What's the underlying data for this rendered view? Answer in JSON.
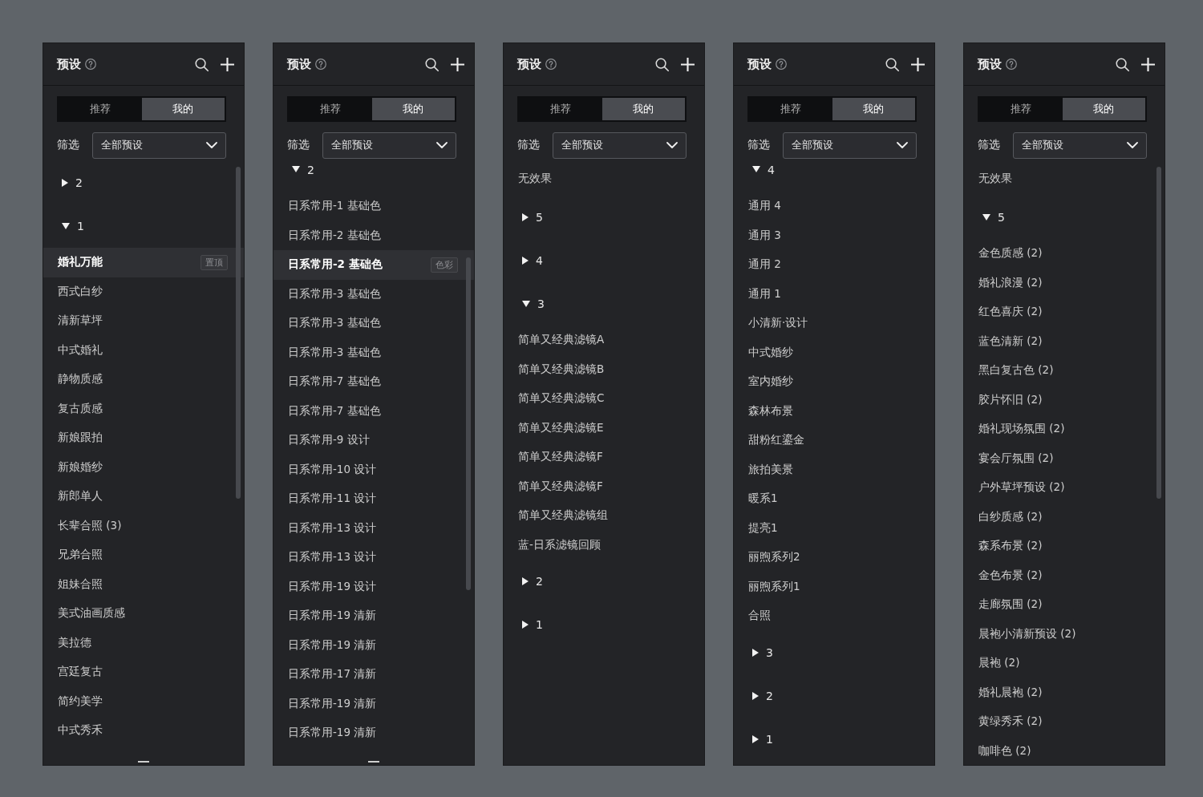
{
  "panels": [
    {
      "title": "预设",
      "tabs": [
        {
          "label": "推荐",
          "selected": false
        },
        {
          "label": "我的",
          "selected": true
        }
      ],
      "filter": {
        "label": "筛选",
        "value": "全部预设"
      },
      "scrolled": false,
      "scrollbar": true,
      "more_below": true,
      "list": [
        {
          "kind": "group",
          "label": "2",
          "expanded": false
        },
        {
          "kind": "group",
          "label": "1",
          "expanded": true,
          "children": [
            {
              "label": "婚礼万能",
              "selected": true,
              "badge": "置顶"
            },
            {
              "label": "西式白纱",
              "selected": false
            },
            {
              "label": "清新草坪",
              "selected": false
            },
            {
              "label": "中式婚礼",
              "selected": false
            },
            {
              "label": "静物质感",
              "selected": false
            },
            {
              "label": "复古质感",
              "selected": false
            },
            {
              "label": "新娘跟拍",
              "selected": false
            },
            {
              "label": "新娘婚纱",
              "selected": false
            },
            {
              "label": "新郎单人",
              "selected": false
            },
            {
              "label": "长辈合照 (3)",
              "selected": false
            },
            {
              "label": "兄弟合照",
              "selected": false
            },
            {
              "label": "姐妹合照",
              "selected": false
            },
            {
              "label": "美式油画质感",
              "selected": false
            },
            {
              "label": "美拉德",
              "selected": false
            },
            {
              "label": "宫廷复古",
              "selected": false
            },
            {
              "label": "简约美学",
              "selected": false
            },
            {
              "label": "中式秀禾",
              "selected": false
            }
          ]
        }
      ]
    },
    {
      "title": "预设",
      "tabs": [
        {
          "label": "推荐",
          "selected": false
        },
        {
          "label": "我的",
          "selected": true
        }
      ],
      "filter": {
        "label": "筛选",
        "value": "全部预设"
      },
      "scrolled": true,
      "scrollbar": true,
      "more_below": true,
      "list": [
        {
          "kind": "group",
          "label": "2",
          "expanded": true,
          "children": [
            {
              "label": "日系常用-1 基础色",
              "selected": false
            },
            {
              "label": "日系常用-2 基础色",
              "selected": false
            },
            {
              "label": "日系常用-2 基础色",
              "selected": true,
              "badge": "色彩"
            },
            {
              "label": "日系常用-3 基础色",
              "selected": false
            },
            {
              "label": "日系常用-3 基础色",
              "selected": false
            },
            {
              "label": "日系常用-3 基础色",
              "selected": false
            },
            {
              "label": "日系常用-7 基础色",
              "selected": false
            },
            {
              "label": "日系常用-7 基础色",
              "selected": false
            },
            {
              "label": "日系常用-9 设计",
              "selected": false
            },
            {
              "label": "日系常用-10 设计",
              "selected": false
            },
            {
              "label": "日系常用-11 设计",
              "selected": false
            },
            {
              "label": "日系常用-13 设计",
              "selected": false
            },
            {
              "label": "日系常用-13 设计",
              "selected": false
            },
            {
              "label": "日系常用-19 设计",
              "selected": false
            },
            {
              "label": "日系常用-19 清新",
              "selected": false
            },
            {
              "label": "日系常用-19 清新",
              "selected": false
            },
            {
              "label": "日系常用-17 清新",
              "selected": false
            },
            {
              "label": "日系常用-19 清新",
              "selected": false
            },
            {
              "label": "日系常用-19 清新",
              "selected": false
            }
          ]
        }
      ]
    },
    {
      "title": "预设",
      "tabs": [
        {
          "label": "推荐",
          "selected": false
        },
        {
          "label": "我的",
          "selected": true
        }
      ],
      "filter": {
        "label": "筛选",
        "value": "全部预设"
      },
      "scrolled": false,
      "scrollbar": false,
      "more_below": false,
      "list": [
        {
          "kind": "item",
          "label": "无效果",
          "selected": false
        },
        {
          "kind": "group",
          "label": "5",
          "expanded": false
        },
        {
          "kind": "group",
          "label": "4",
          "expanded": false
        },
        {
          "kind": "group",
          "label": "3",
          "expanded": true,
          "children": [
            {
              "label": "简单又经典滤镜A",
              "selected": false
            },
            {
              "label": "简单又经典滤镜B",
              "selected": false
            },
            {
              "label": "简单又经典滤镜C",
              "selected": false
            },
            {
              "label": "简单又经典滤镜E",
              "selected": false
            },
            {
              "label": "简单又经典滤镜F",
              "selected": false
            },
            {
              "label": "简单又经典滤镜F",
              "selected": false
            },
            {
              "label": "简单又经典滤镜组",
              "selected": false
            },
            {
              "label": "蓝-日系滤镜回顾",
              "selected": false
            }
          ]
        },
        {
          "kind": "group",
          "label": "2",
          "expanded": false
        },
        {
          "kind": "group",
          "label": "1",
          "expanded": false
        }
      ]
    },
    {
      "title": "预设",
      "tabs": [
        {
          "label": "推荐",
          "selected": false
        },
        {
          "label": "我的",
          "selected": true
        }
      ],
      "filter": {
        "label": "筛选",
        "value": "全部预设"
      },
      "scrolled": true,
      "scrollbar": false,
      "more_below": false,
      "list": [
        {
          "kind": "group",
          "label": "4",
          "expanded": true,
          "children": [
            {
              "label": "通用 4",
              "selected": false
            },
            {
              "label": "通用 3",
              "selected": false
            },
            {
              "label": "通用 2",
              "selected": false
            },
            {
              "label": "通用 1",
              "selected": false
            },
            {
              "label": "小清新·设计",
              "selected": false
            },
            {
              "label": "中式婚纱",
              "selected": false
            },
            {
              "label": "室内婚纱",
              "selected": false
            },
            {
              "label": "森林布景",
              "selected": false
            },
            {
              "label": "甜粉红鎏金",
              "selected": false
            },
            {
              "label": "旅拍美景",
              "selected": false
            },
            {
              "label": "暖系1",
              "selected": false
            },
            {
              "label": "提亮1",
              "selected": false
            },
            {
              "label": "丽煦系列2",
              "selected": false
            },
            {
              "label": "丽煦系列1",
              "selected": false
            },
            {
              "label": "合照",
              "selected": false
            }
          ]
        },
        {
          "kind": "group",
          "label": "3",
          "expanded": false
        },
        {
          "kind": "group",
          "label": "2",
          "expanded": false
        },
        {
          "kind": "group",
          "label": "1",
          "expanded": false
        }
      ]
    },
    {
      "title": "预设",
      "tabs": [
        {
          "label": "推荐",
          "selected": false
        },
        {
          "label": "我的",
          "selected": true
        }
      ],
      "filter": {
        "label": "筛选",
        "value": "全部预设"
      },
      "scrolled": false,
      "scrollbar": true,
      "more_below": false,
      "list": [
        {
          "kind": "item",
          "label": "无效果",
          "selected": false
        },
        {
          "kind": "group",
          "label": "5",
          "expanded": true,
          "children": [
            {
              "label": "金色质感 (2)",
              "selected": false
            },
            {
              "label": "婚礼浪漫 (2)",
              "selected": false
            },
            {
              "label": "红色喜庆 (2)",
              "selected": false
            },
            {
              "label": "蓝色清新 (2)",
              "selected": false
            },
            {
              "label": "黑白复古色 (2)",
              "selected": false
            },
            {
              "label": "胶片怀旧 (2)",
              "selected": false
            },
            {
              "label": "婚礼现场氛围 (2)",
              "selected": false
            },
            {
              "label": "宴会厅氛围 (2)",
              "selected": false
            },
            {
              "label": "户外草坪预设 (2)",
              "selected": false
            },
            {
              "label": "白纱质感 (2)",
              "selected": false
            },
            {
              "label": "森系布景 (2)",
              "selected": false
            },
            {
              "label": "金色布景 (2)",
              "selected": false
            },
            {
              "label": "走廊氛围 (2)",
              "selected": false
            },
            {
              "label": "晨袍小清新预设 (2)",
              "selected": false
            },
            {
              "label": "晨袍 (2)",
              "selected": false
            },
            {
              "label": "婚礼晨袍 (2)",
              "selected": false
            },
            {
              "label": "黄绿秀禾 (2)",
              "selected": false
            },
            {
              "label": "咖啡色 (2)",
              "selected": false
            }
          ]
        }
      ]
    }
  ]
}
